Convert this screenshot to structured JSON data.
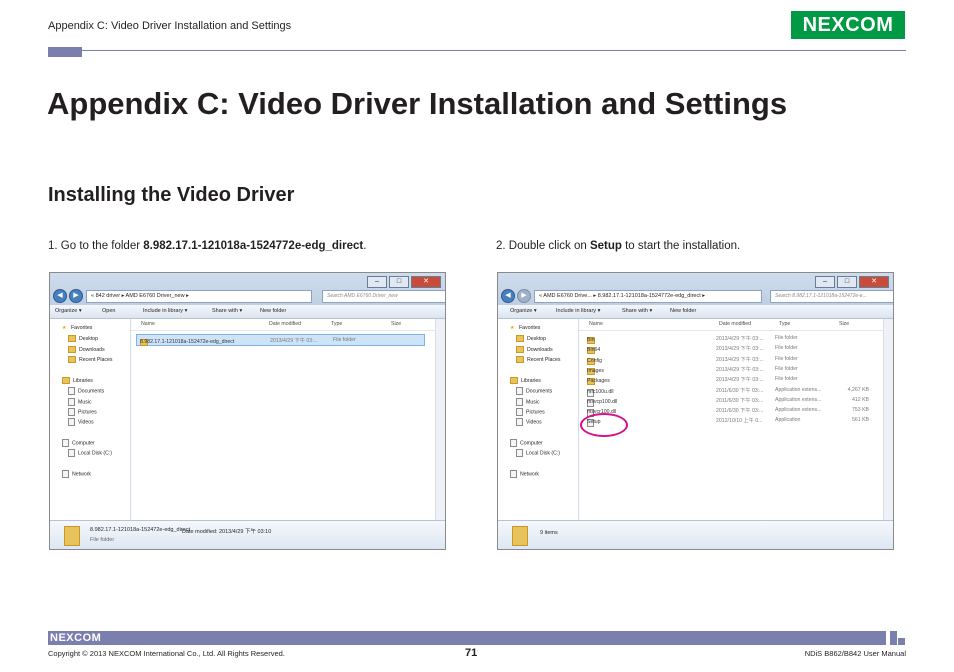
{
  "header": {
    "running_title": "Appendix C: Video Driver Installation and Settings",
    "logo_text": "NE COM",
    "logo_x": "X"
  },
  "page_title": "Appendix C: Video Driver Installation and Settings",
  "section_title": "Installing the Video Driver",
  "steps": [
    {
      "prefix": "1.  Go to the folder ",
      "bold": "8.982.17.1-121018a-1524772e-edg_direct",
      "suffix": "."
    },
    {
      "prefix": "2.  Double click on ",
      "bold": "Setup",
      "suffix": " to start the installation."
    }
  ],
  "window1": {
    "address": "« 842 driver  ▸  AMD E6760 Driver_new  ▸",
    "search": "Search AMD E6760 Driver_new",
    "toolbar": [
      "Organize ▾",
      "Open",
      "Include in library ▾",
      "Share with ▾",
      "New folder"
    ],
    "nav": {
      "favorites": "Favorites",
      "desktop": "Desktop",
      "downloads": "Downloads",
      "recent": "Recent Places",
      "libraries": "Libraries",
      "documents": "Documents",
      "music": "Music",
      "pictures": "Pictures",
      "videos": "Videos",
      "computer": "Computer",
      "localdisk": "Local Disk (C:)",
      "network": "Network"
    },
    "columns": [
      "Name",
      "Date modified",
      "Type",
      "Size"
    ],
    "rows": [
      {
        "name": "8.982.17.1-121018a-152472e-edg_direct",
        "date": "2013/4/29 下午 03:...",
        "type": "File folder",
        "size": ""
      }
    ],
    "status_name": "8.982.17.1-121018a-152472e-edg_direct",
    "status_date": "Date modified: 2013/4/29 下午 03:10",
    "status_type": "File folder"
  },
  "window2": {
    "address": "« AMD E6760 Drive...  ▸  8.982.17.1-121018a-1524772e-edg_direct  ▸",
    "search": "Search 8.982.17.1-121018a-152472e-e...",
    "toolbar": [
      "Organize ▾",
      "Include in library ▾",
      "Share with ▾",
      "New folder"
    ],
    "nav": {
      "favorites": "Favorites",
      "desktop": "Desktop",
      "downloads": "Downloads",
      "recent": "Recent Places",
      "libraries": "Libraries",
      "documents": "Documents",
      "music": "Music",
      "pictures": "Pictures",
      "videos": "Videos",
      "computer": "Computer",
      "localdisk": "Local Disk (C:)",
      "network": "Network"
    },
    "columns": [
      "Name",
      "Date modified",
      "Type",
      "Size"
    ],
    "rows": [
      {
        "name": "Bin",
        "date": "2013/4/29 下午 03:...",
        "type": "File folder",
        "size": "",
        "icon": "folder"
      },
      {
        "name": "Bin64",
        "date": "2013/4/29 下午 03:...",
        "type": "File folder",
        "size": "",
        "icon": "folder"
      },
      {
        "name": "Config",
        "date": "2013/4/29 下午 03:...",
        "type": "File folder",
        "size": "",
        "icon": "folder"
      },
      {
        "name": "Images",
        "date": "2013/4/29 下午 03:...",
        "type": "File folder",
        "size": "",
        "icon": "folder"
      },
      {
        "name": "Packages",
        "date": "2013/4/29 下午 03:...",
        "type": "File folder",
        "size": "",
        "icon": "folder"
      },
      {
        "name": "mfc100u.dll",
        "date": "2011/6/30 下午 03:...",
        "type": "Application extens...",
        "size": "4,267 KB",
        "icon": "file"
      },
      {
        "name": "msvcp100.dll",
        "date": "2011/6/30 下午 03:...",
        "type": "Application extens...",
        "size": "412 KB",
        "icon": "file"
      },
      {
        "name": "msvcr100.dll",
        "date": "2011/6/30 下午 03:...",
        "type": "Application extens...",
        "size": "753 KB",
        "icon": "file"
      },
      {
        "name": "Setup",
        "date": "2012/10/10 上午 0...",
        "type": "Application",
        "size": "561 KB",
        "icon": "file"
      }
    ],
    "status_count": "9 items"
  },
  "footer": {
    "logo": "NE COM",
    "logo_x": "X",
    "copyright": "Copyright © 2013 NEXCOM International Co., Ltd. All Rights Reserved.",
    "page_number": "71",
    "manual": "NDiS B862/B842 User Manual"
  }
}
